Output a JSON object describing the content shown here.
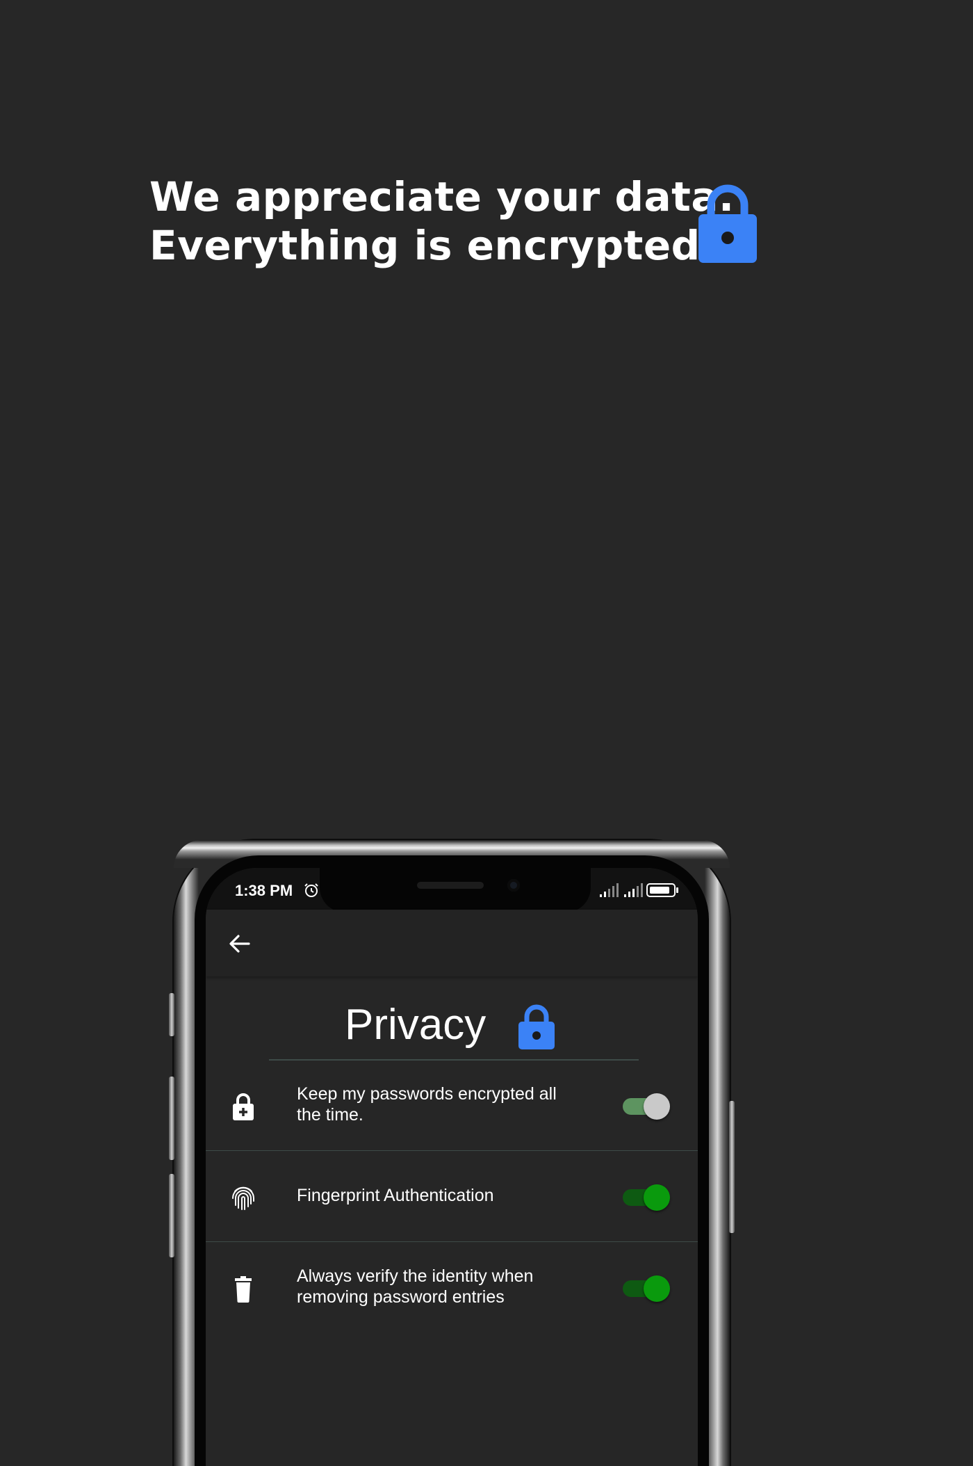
{
  "headline": {
    "line1": "We appreciate your data.",
    "line2": "Everything is encrypted."
  },
  "colors": {
    "background": "#272727",
    "accent": "#3b82f6",
    "toggle_on_track": "#0e5a12",
    "toggle_on_knob": "#0a9a0d",
    "toggle_mixed_track": "#5d9460",
    "toggle_mixed_knob": "#c9c9c9",
    "divider": "#3e4b48"
  },
  "phone": {
    "status_bar": {
      "time": "1:38 PM",
      "icons": [
        "alarm-icon",
        "signal-icon",
        "signal-icon",
        "battery-icon"
      ]
    },
    "app_bar": {
      "back_icon": "arrow-left-icon"
    },
    "screen_title": "Privacy",
    "settings": [
      {
        "icon": "lock-plus-icon",
        "label": "Keep my passwords encrypted all the time.",
        "enabled": true
      },
      {
        "icon": "fingerprint-icon",
        "label": "Fingerprint Authentication",
        "enabled": true
      },
      {
        "icon": "trash-icon",
        "label": "Always verify the identity when removing password entries",
        "enabled": true
      }
    ]
  }
}
